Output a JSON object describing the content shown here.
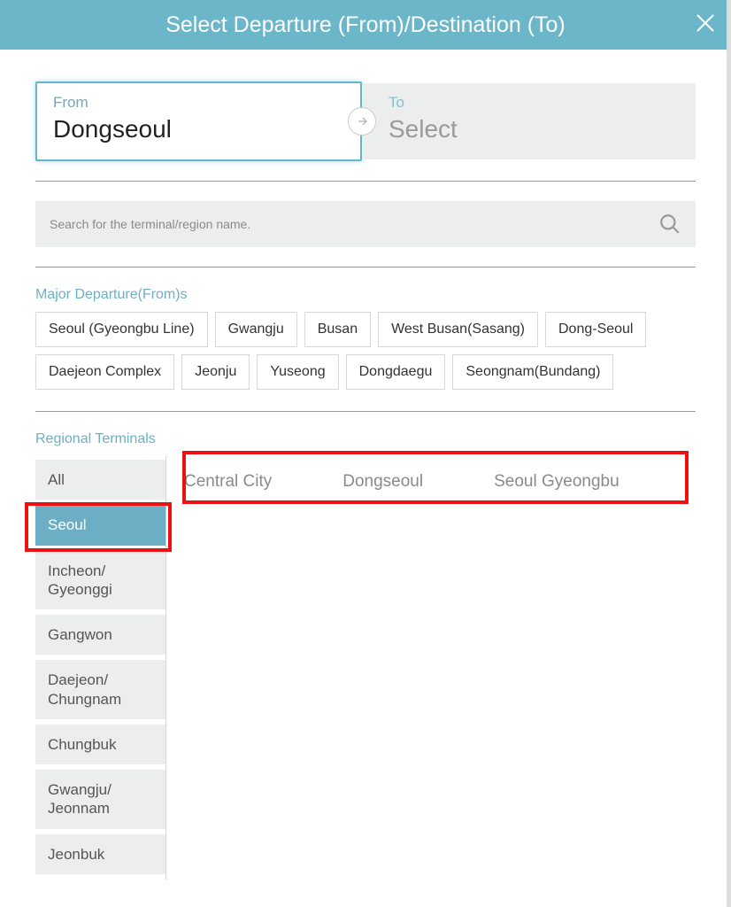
{
  "header": {
    "title": "Select Departure (From)/Destination (To)"
  },
  "from": {
    "label": "From",
    "value": "Dongseoul"
  },
  "to": {
    "label": "To",
    "value": "Select"
  },
  "search": {
    "placeholder": "Search for the terminal/region name."
  },
  "major": {
    "title": "Major Departure(From)s",
    "items": [
      "Seoul (Gyeongbu Line)",
      "Gwangju",
      "Busan",
      "West Busan(Sasang)",
      "Dong-Seoul",
      "Daejeon Complex",
      "Jeonju",
      "Yuseong",
      "Dongdaegu",
      "Seongnam(Bundang)"
    ]
  },
  "regional": {
    "title": "Regional Terminals",
    "regions": [
      "All",
      "Seoul",
      "Incheon/ Gyeonggi",
      "Gangwon",
      "Daejeon/ Chungnam",
      "Chungbuk",
      "Gwangju/ Jeonnam",
      "Jeonbuk"
    ],
    "active_index": 1,
    "terminals": [
      "Central City",
      "Dongseoul",
      "Seoul Gyeongbu"
    ]
  }
}
